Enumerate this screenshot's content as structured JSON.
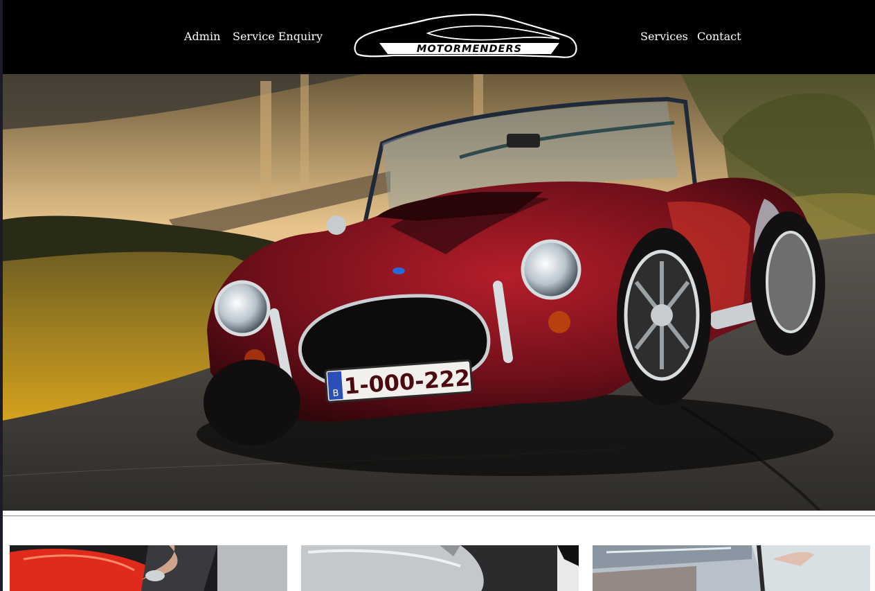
{
  "nav": {
    "left_links": [
      "Admin",
      "Service Enquiry"
    ],
    "right_links": [
      "Services",
      "Contact"
    ],
    "logo_text": "MOTORMENDERS"
  },
  "hero": {
    "plate_country": "B",
    "plate_number": "1-000-222"
  },
  "colors": {
    "nav_bg": "#000000",
    "nav_text": "#ffffff",
    "car_body": "#6e0f1a",
    "divider": "#8c8c8c"
  },
  "cards": [
    {
      "icon": "red-car-polishing-image"
    },
    {
      "icon": "silver-car-bonnet-image"
    },
    {
      "icon": "workshop-technician-image"
    }
  ]
}
